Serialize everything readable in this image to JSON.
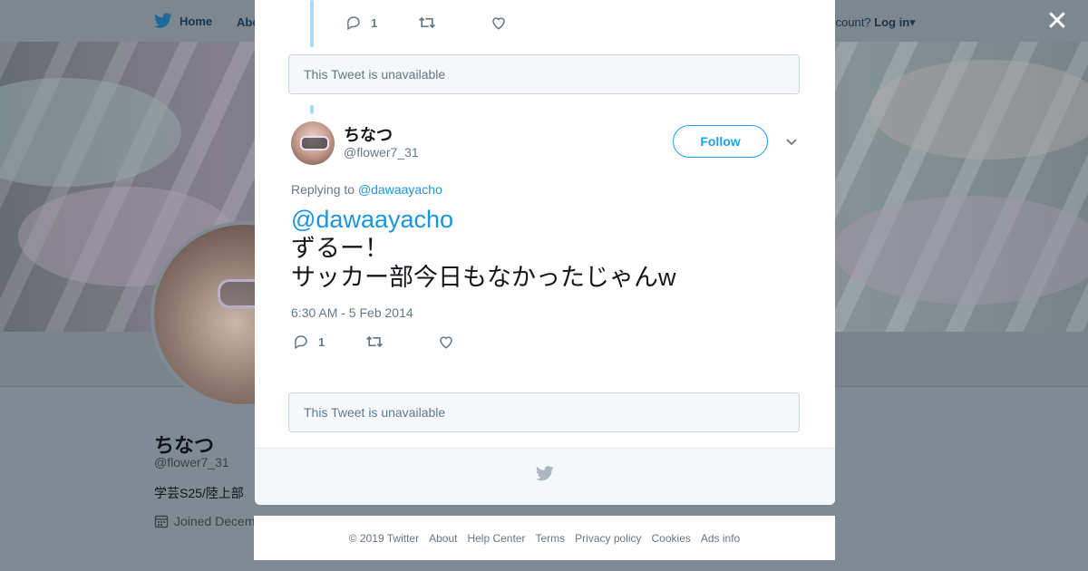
{
  "topnav": {
    "home_label": "Home",
    "about_label": "Abo",
    "account_prompt": "ccount?",
    "login_label": "Log in"
  },
  "profile": {
    "name": "ちなつ",
    "handle": "@flower7_31",
    "bio": "学芸S25/陸上部",
    "joined": "Joined Decem"
  },
  "modal": {
    "previous_tweet": {
      "reply_count": "1"
    },
    "unavailable_1": "This Tweet is unavailable",
    "tweet": {
      "name": "ちなつ",
      "handle": "@flower7_31",
      "follow_label": "Follow",
      "replying_prefix": "Replying to",
      "replying_to": "@dawaayacho",
      "mention": "@dawaayacho",
      "line1": "ずるー！",
      "line2": "サッカー部今日もなかったじゃんw",
      "timestamp": "6:30 AM - 5 Feb 2014",
      "reply_count": "1"
    },
    "unavailable_2": "This Tweet is unavailable"
  },
  "footer": {
    "copyright": "© 2019 Twitter",
    "links": [
      "About",
      "Help Center",
      "Terms",
      "Privacy policy",
      "Cookies",
      "Ads info"
    ]
  },
  "colors": {
    "accent": "#1da1f2",
    "link": "#1b95e0",
    "thread_line": "#a9dbf8",
    "overlay": "#7f8a94"
  }
}
